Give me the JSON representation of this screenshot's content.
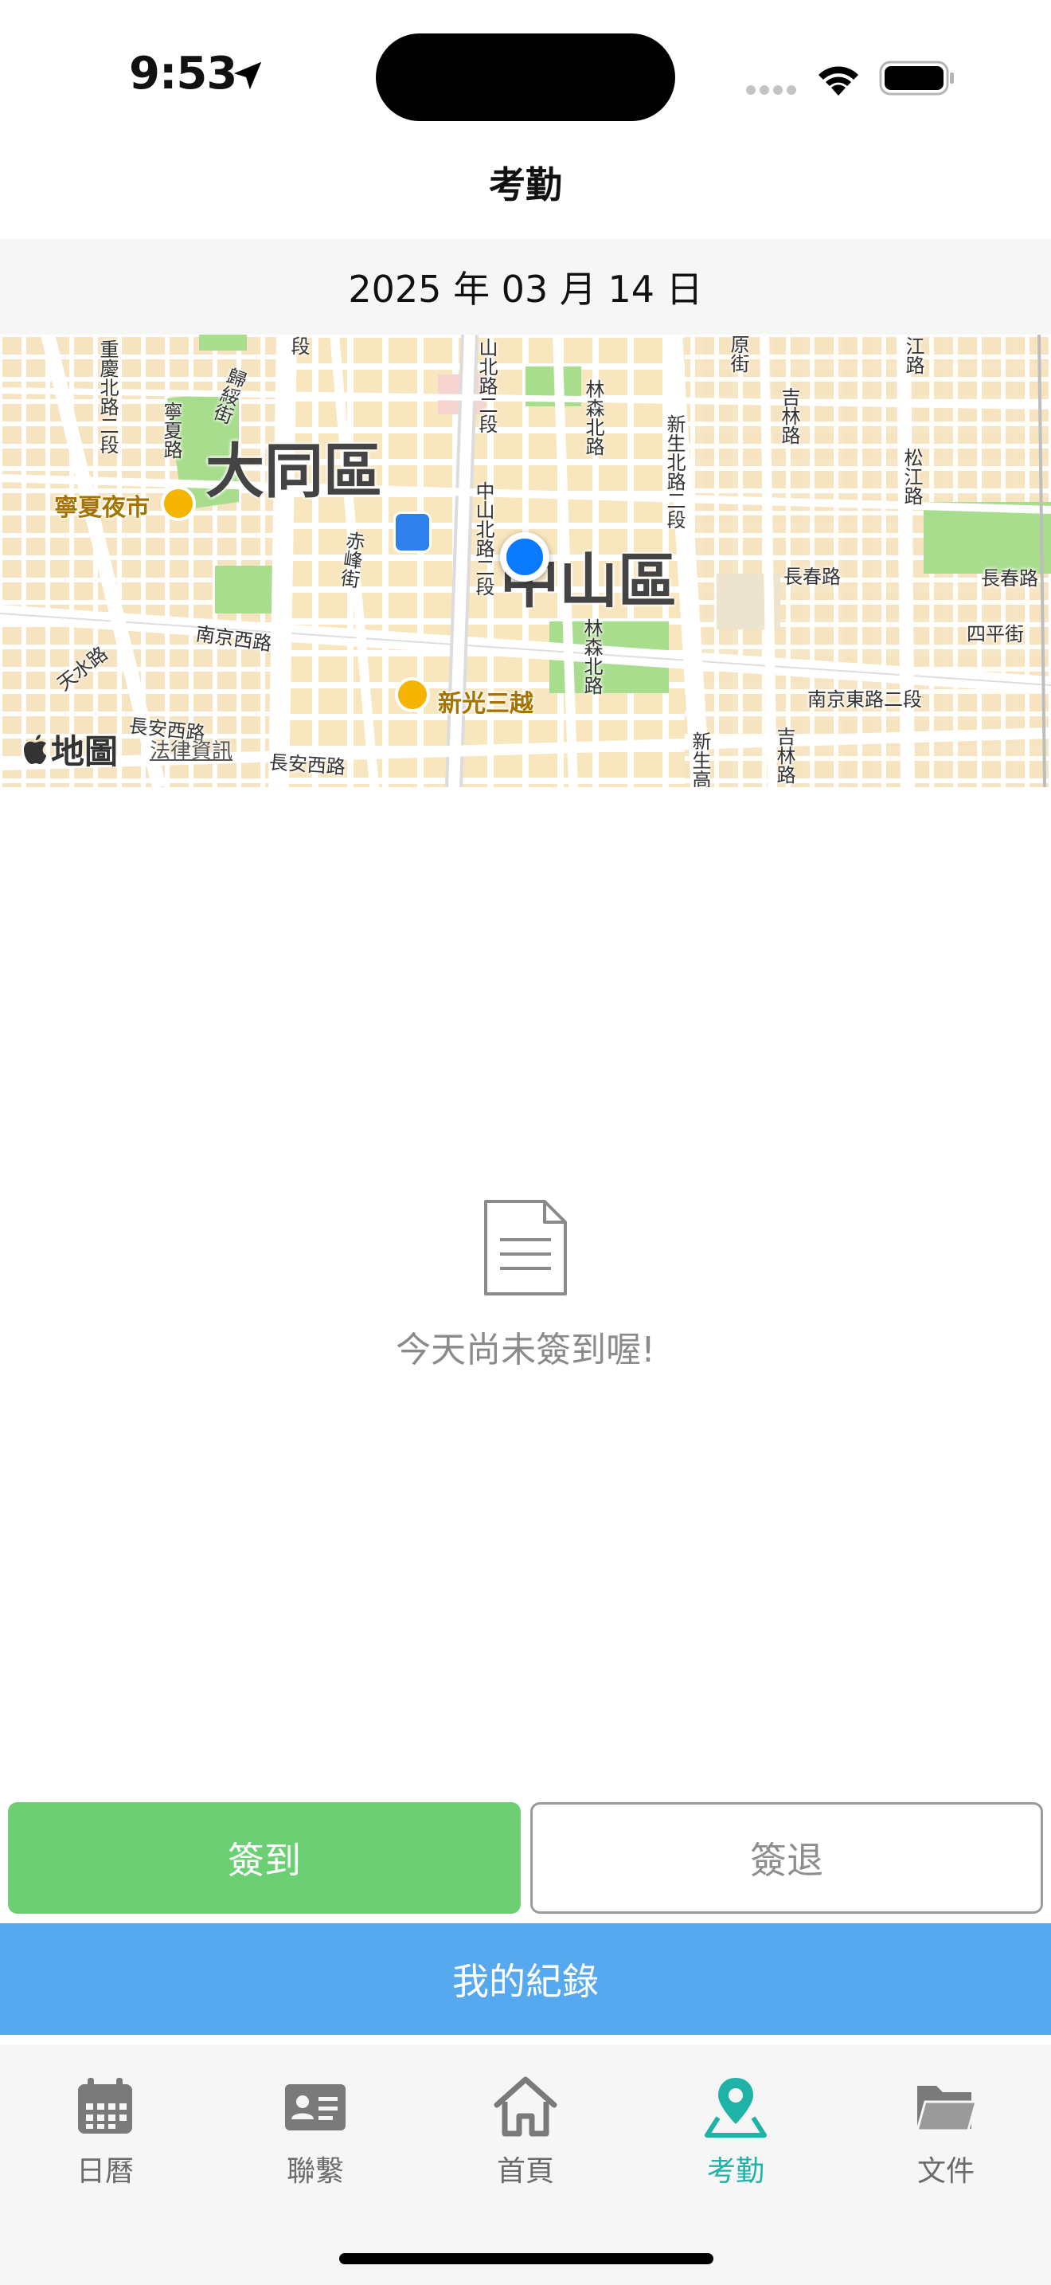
{
  "status_bar": {
    "time": "9:53",
    "icons": [
      "location-arrow-icon",
      "cellular-dots-icon",
      "wifi-icon",
      "battery-icon"
    ]
  },
  "header": {
    "title": "考勤"
  },
  "date": {
    "text": "2025 年 03 月 14 日"
  },
  "map": {
    "districts": [
      "大同區",
      "中山區"
    ],
    "roads": {
      "horizontal": [
        "南京西路",
        "天水路",
        "長安西路",
        "長安西路",
        "長春路",
        "長春路",
        "四平街",
        "南京東路二段"
      ],
      "vertical": [
        "重慶北路二段",
        "寧夏路",
        "歸綏街",
        "段",
        "赤峰街",
        "山北路二段",
        "中山北路二段",
        "林森北路",
        "林森北路",
        "新生北路二段",
        "新生高",
        "吉林路",
        "吉林路",
        "松江路",
        "江路",
        "原街"
      ]
    },
    "pois": [
      "寧夏夜市",
      "新光三越"
    ],
    "brand": "地圖",
    "legal": "法律資訊",
    "colors": {
      "land": "#f7ecd6",
      "road": "#ffffff",
      "park": "#a9dd8e",
      "poi_text": "#a57300",
      "user_location": "#0a7aff"
    }
  },
  "empty_state": {
    "icon": "document-icon",
    "text": "今天尚未簽到喔!"
  },
  "actions": {
    "check_in": "簽到",
    "check_out": "簽退",
    "records": "我的紀錄",
    "colors": {
      "check_in": "#6ccf73",
      "records": "#56a9ee"
    }
  },
  "tabs": [
    {
      "label": "日曆",
      "icon": "calendar-icon",
      "active": false
    },
    {
      "label": "聯繫",
      "icon": "contact-card-icon",
      "active": false
    },
    {
      "label": "首頁",
      "icon": "home-icon",
      "active": false
    },
    {
      "label": "考勤",
      "icon": "map-pin-icon",
      "active": true
    },
    {
      "label": "文件",
      "icon": "folder-icon",
      "active": false
    }
  ],
  "theme": {
    "tab_active": "#1fb2a6",
    "tab_inactive": "#6b6b6b"
  }
}
